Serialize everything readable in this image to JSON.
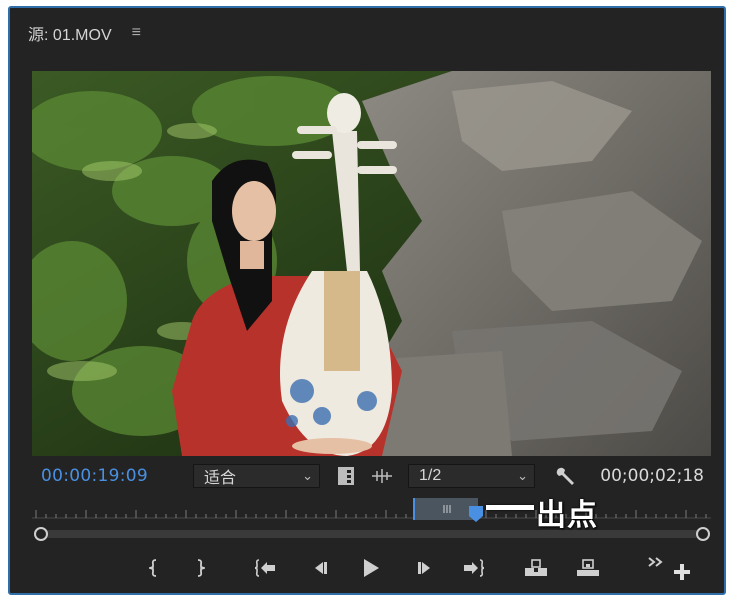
{
  "panel": {
    "title_prefix": "源",
    "title_sep": ":",
    "clip_name": "01.MOV",
    "menu_icon": "hamburger-menu-icon"
  },
  "controls": {
    "current_timecode": "00:00:19:09",
    "zoom_select": "适合",
    "resolution_select": "1/2",
    "duration_timecode": "00;00;02;18",
    "accent_color": "#4a90e2"
  },
  "annotation": {
    "label": "出点"
  },
  "transport": {
    "buttons": [
      "mark-in-icon",
      "mark-out-icon",
      "go-to-in-icon",
      "step-back-icon",
      "play-icon",
      "step-forward-icon",
      "go-to-out-icon",
      "insert-icon",
      "overwrite-icon",
      "more-icon",
      "add-button-icon"
    ]
  }
}
